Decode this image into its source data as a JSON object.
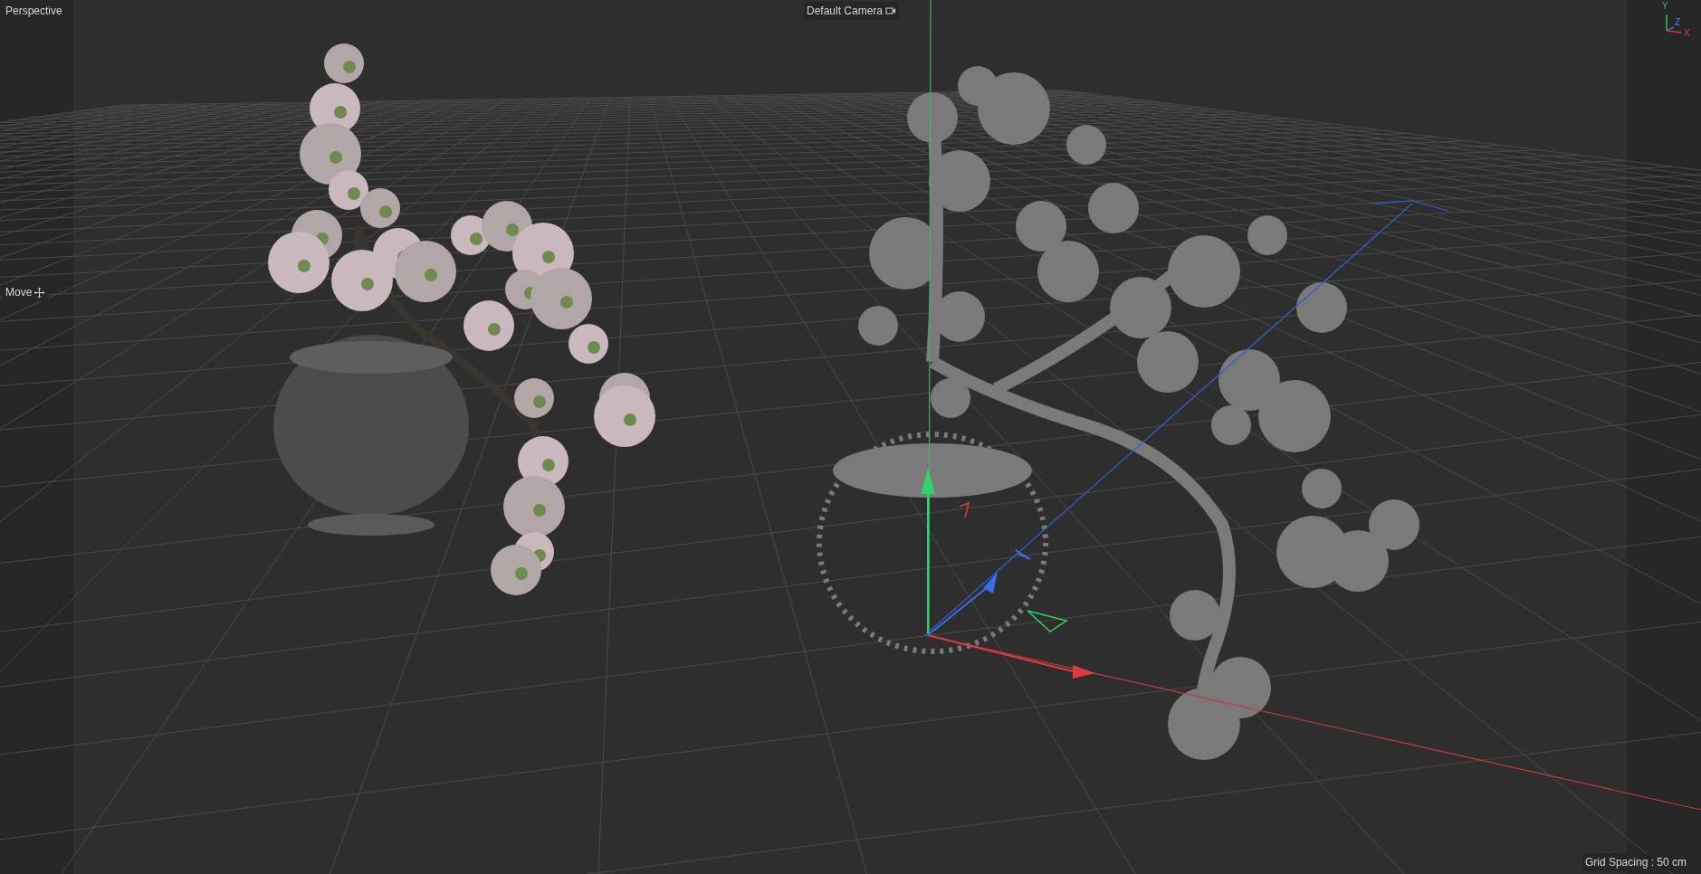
{
  "viewport": {
    "view_name": "Perspective",
    "camera": "Default Camera",
    "tool": "Move",
    "axis_labels": [
      "Y",
      "Z",
      "X"
    ],
    "grid_spacing": "Grid Spacing : 50 cm"
  }
}
